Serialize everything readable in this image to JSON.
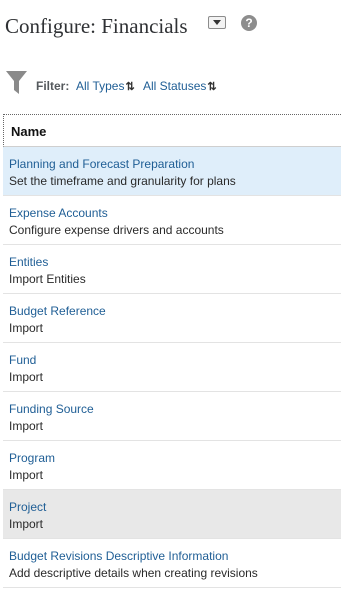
{
  "header": {
    "title": "Configure: Financials",
    "help_glyph": "?"
  },
  "filter": {
    "label": "Filter:",
    "types": "All Types",
    "statuses": "All Statuses",
    "sort_glyph": "⇅"
  },
  "table": {
    "column_name": "Name",
    "rows": [
      {
        "title": "Planning and Forecast Preparation",
        "desc": "Set the timeframe and granularity for plans",
        "state": "selected"
      },
      {
        "title": "Expense Accounts",
        "desc": "Configure expense drivers and accounts",
        "state": "normal"
      },
      {
        "title": "Entities",
        "desc": "Import Entities",
        "state": "normal"
      },
      {
        "title": "Budget Reference",
        "desc": "Import",
        "state": "normal"
      },
      {
        "title": "Fund",
        "desc": "Import",
        "state": "normal"
      },
      {
        "title": "Funding Source",
        "desc": "Import",
        "state": "normal"
      },
      {
        "title": "Program",
        "desc": "Import",
        "state": "normal"
      },
      {
        "title": "Project",
        "desc": "Import",
        "state": "hover"
      },
      {
        "title": "Budget Revisions Descriptive Information",
        "desc": "Add descriptive details when creating revisions",
        "state": "normal"
      }
    ]
  },
  "icons": {
    "dropdown": "caret-down-icon",
    "help": "help-icon",
    "filter": "funnel-icon",
    "sort": "sort-icon"
  },
  "colors": {
    "link": "#1f5e95",
    "selected_row": "#dfeefa",
    "hover_row": "#e8e8e8"
  }
}
